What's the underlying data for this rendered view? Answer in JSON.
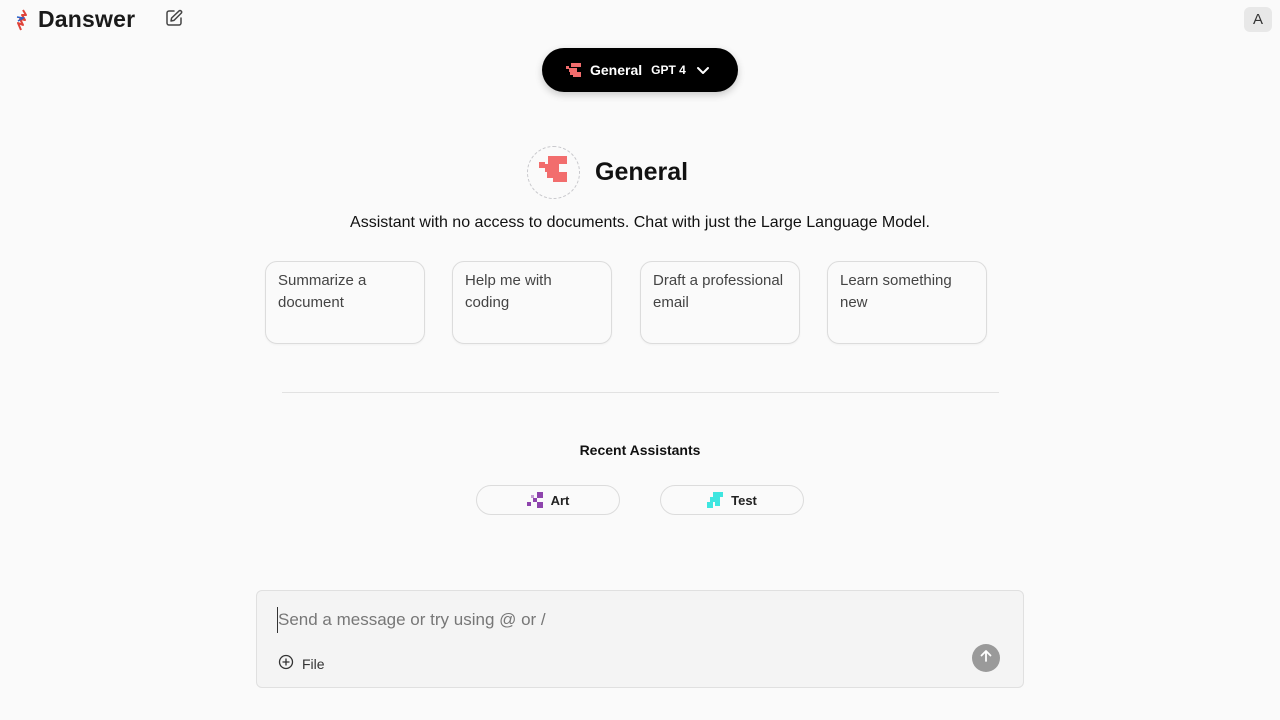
{
  "app": {
    "name": "Danswer",
    "user_initial": "A"
  },
  "picker": {
    "assistant_name": "General",
    "model": "GPT 4"
  },
  "assistant": {
    "name": "General",
    "description": "Assistant with no access to documents. Chat with just the Large Language Model."
  },
  "starters": [
    {
      "label": "Summarize a document"
    },
    {
      "label": "Help me with coding"
    },
    {
      "label": "Draft a professional email"
    },
    {
      "label": "Learn something new"
    }
  ],
  "recent": {
    "title": "Recent Assistants",
    "items": [
      {
        "name": "Art",
        "color": "#8e44ad"
      },
      {
        "name": "Test",
        "color": "#3fe6e0"
      }
    ]
  },
  "composer": {
    "placeholder": "Send a message or try using @ or /",
    "file_label": "File"
  },
  "colors": {
    "accent_black": "#000000",
    "assistant_icon": "#f26d6d",
    "send_disabled": "#9a9a9a"
  }
}
